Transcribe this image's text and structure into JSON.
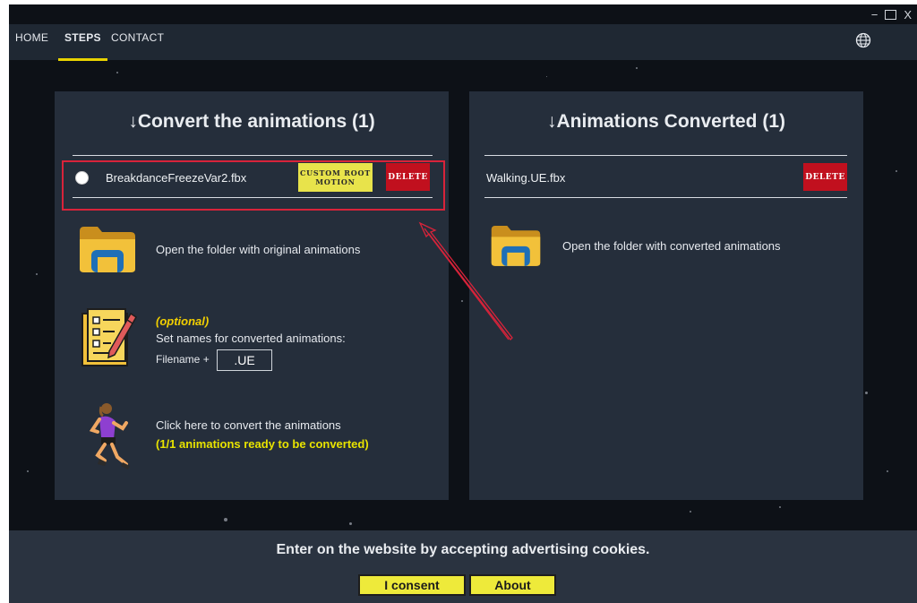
{
  "window": {
    "minimize": "−",
    "close": "X"
  },
  "nav": {
    "items": [
      {
        "label": "HOME"
      },
      {
        "label": "STEPS"
      },
      {
        "label": "CONTACT"
      }
    ]
  },
  "convert_panel": {
    "title": "↓Convert the animations (1)",
    "file": {
      "name": "BreakdanceFreezeVar2.fbx",
      "custom_root_motion": "CUSTOM ROOT MOTION",
      "delete": "DELETE"
    },
    "open_folder": "Open the folder with original animations",
    "optional": "(optional)",
    "set_names": "Set names for converted animations:",
    "filename_label": "Filename +",
    "filename_suffix": ".UE",
    "convert_action": "Click here to convert the animations",
    "ready_status": "(1/1 animations ready to be converted)"
  },
  "converted_panel": {
    "title": "↓Animations Converted (1)",
    "file": {
      "name": "Walking.UE.fbx",
      "delete": "DELETE"
    },
    "open_folder": "Open the folder with converted animations"
  },
  "cookie": {
    "text": "Enter on the website by accepting advertising cookies.",
    "consent": "I consent",
    "about": "About"
  },
  "icons": {
    "globe": "globe-icon",
    "folder": "folder-icon",
    "notepad": "notepad-pencil-icon",
    "runner": "runner-icon"
  },
  "colors": {
    "nav_bg": "#1f2833",
    "panel_bg": "#252e3b",
    "accent_yellow": "#e8e34b",
    "delete_red": "#c1101e",
    "highlight_red": "#d8233a"
  }
}
